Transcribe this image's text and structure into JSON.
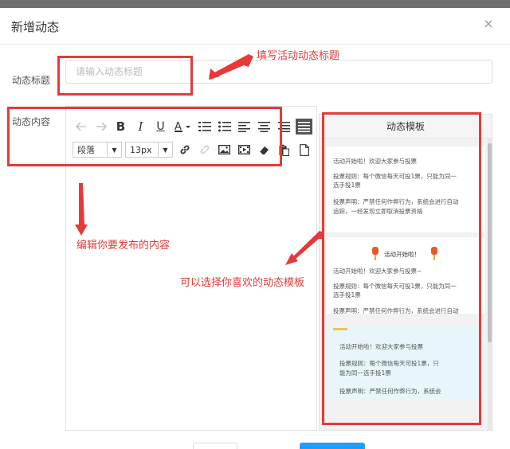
{
  "dialog": {
    "title": "新增动态",
    "close_glyph": "×"
  },
  "form": {
    "title_label": "动态标题",
    "title_placeholder": "请输入动态标题",
    "title_value": "",
    "content_label": "动态内容"
  },
  "toolbar": {
    "paragraph_value": "段落",
    "fontsize_value": "13px"
  },
  "template_panel": {
    "title": "动态模板",
    "card1": {
      "line1": "活动开始啦！欢迎大家参与投票",
      "line2a": "投票规则：每个微信每天可投1票，只能为同一",
      "line2b": "选手投1票",
      "line3a": "投票声明：严禁任何作弊行为，系统会进行自动",
      "line3b": "追踪，一经发现立即取消投票资格"
    },
    "card2": {
      "heading": "活动开始啦！",
      "line1": "活动开始啦！欢迎大家参与投票~",
      "line2a": "投票规则：每个微信每天可投1票，只能为同一",
      "line2b": "选手投1票",
      "line3": "投票声明：严禁任何作弊行为，系统会进行自动"
    },
    "card3": {
      "line1": "活动开始啦！欢迎大家参与投票",
      "line2a": "投票规则：每个微信每天可投1票，只",
      "line2b": "能为同一选手投1票",
      "line3": "投票声明：严禁任何作弊行为，系统会"
    }
  },
  "annotations": {
    "title_hint": "填写活动动态标题",
    "content_hint": "编辑你要发布的内容",
    "template_hint": "可以选择你喜欢的动态模板"
  },
  "colors": {
    "annotation_red": "#e63a3a",
    "toolbar_active_bg": "#555555",
    "template_highlight_bg": "#e8f6fb"
  },
  "icons": [
    "undo-icon",
    "redo-icon",
    "bold-icon",
    "italic-icon",
    "underline-icon",
    "font-color-icon",
    "ordered-list-icon",
    "unordered-list-icon",
    "align-left-icon",
    "align-center-icon",
    "align-right-icon",
    "align-justify-icon",
    "link-icon",
    "unlink-icon",
    "image-icon",
    "video-icon",
    "eraser-icon",
    "paste-icon",
    "new-doc-icon",
    "lantern-icon"
  ]
}
